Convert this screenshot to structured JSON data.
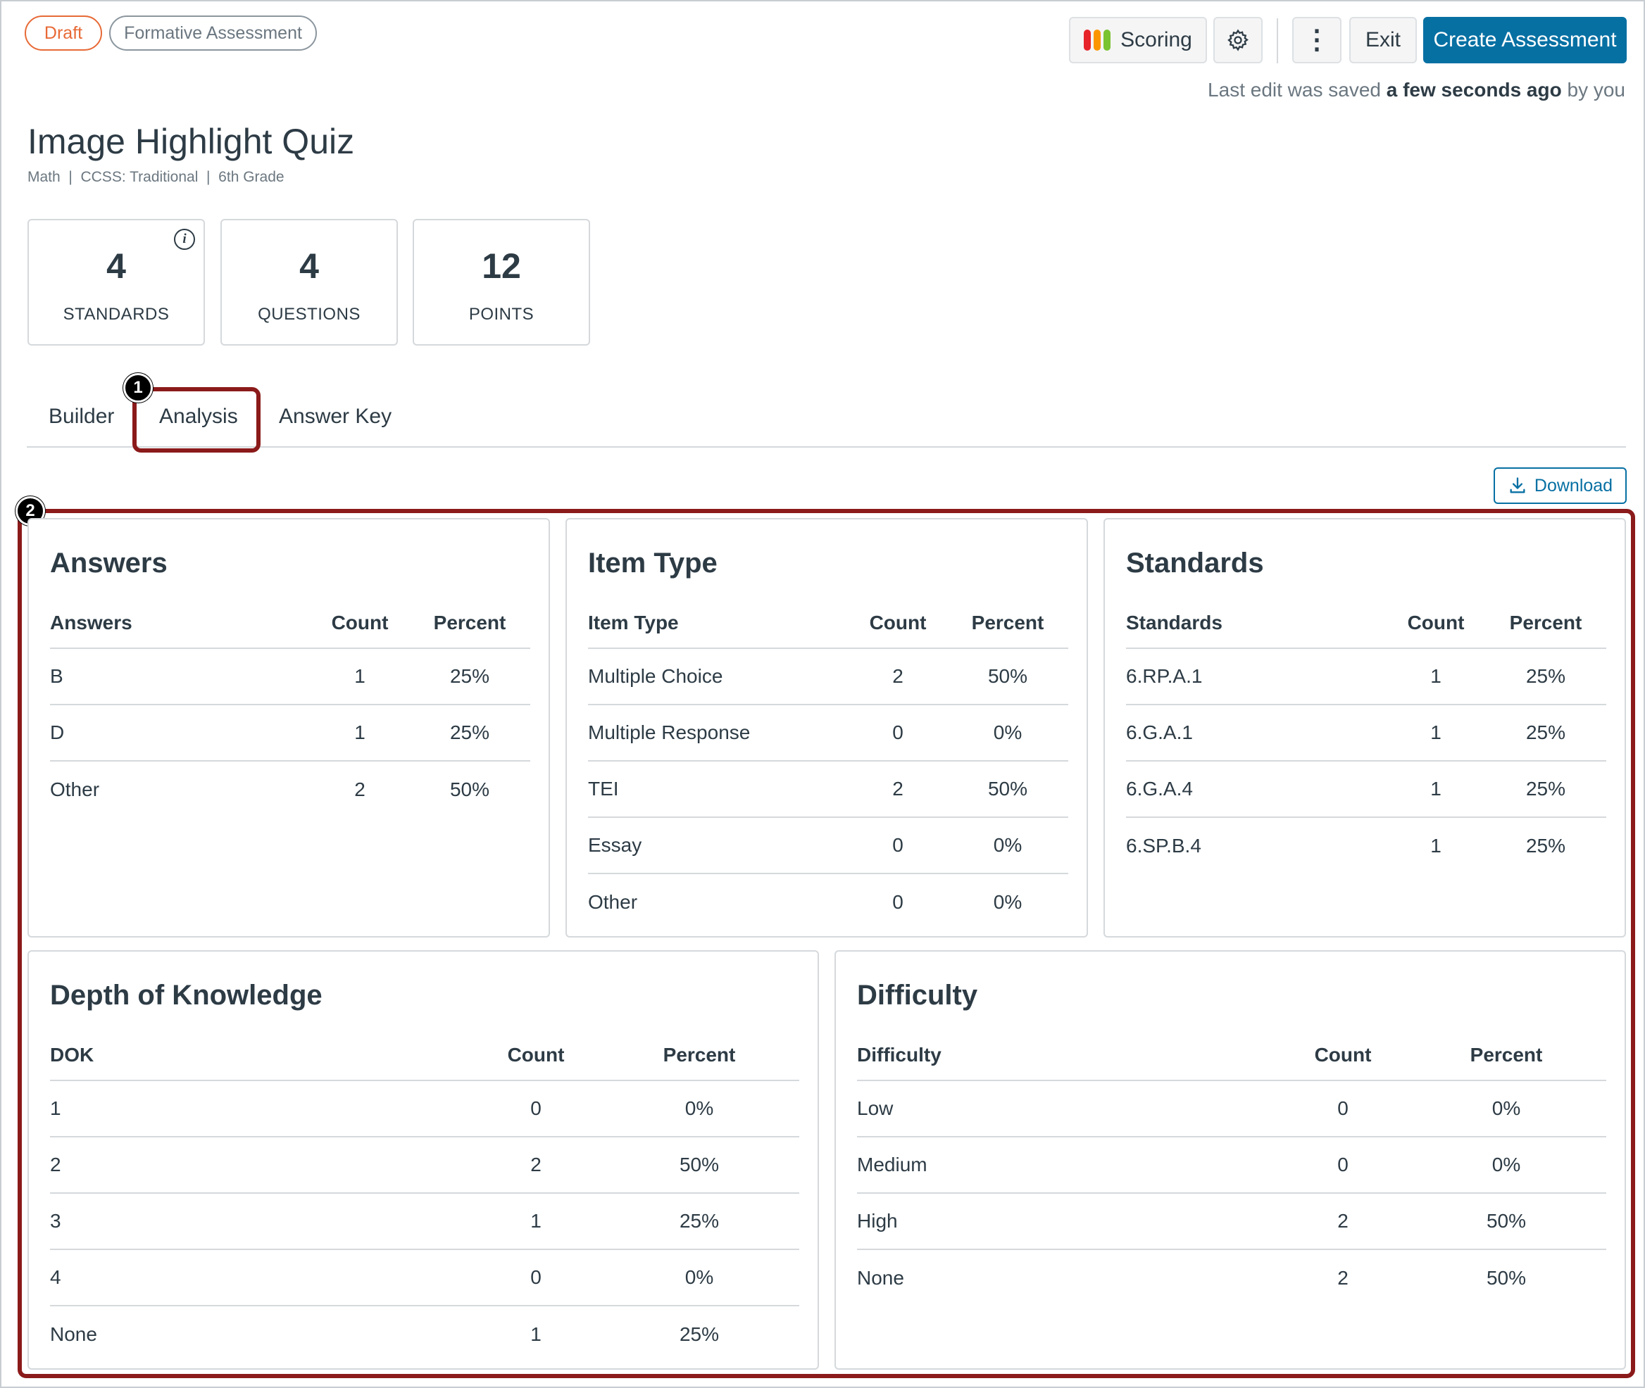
{
  "pills": {
    "draft": "Draft",
    "formative": "Formative Assessment"
  },
  "toolbar": {
    "scoring_label": "Scoring",
    "exit_label": "Exit",
    "create_label": "Create Assessment",
    "kebab": "⋮"
  },
  "saved": {
    "prefix": "Last edit was saved",
    "bold": "a few seconds ago",
    "suffix": "by you"
  },
  "header": {
    "title": "Image Highlight Quiz",
    "subtitle": "Math  |  CCSS: Traditional  |  6th Grade"
  },
  "stats": [
    {
      "value": "4",
      "label": "STANDARDS"
    },
    {
      "value": "4",
      "label": "QUESTIONS"
    },
    {
      "value": "12",
      "label": "POINTS"
    }
  ],
  "tabs": {
    "builder": "Builder",
    "analysis": "Analysis",
    "answer_key": "Answer Key"
  },
  "badges": {
    "one": "1",
    "two": "2"
  },
  "download_label": "Download",
  "colors": {
    "primary": "#0770a3",
    "draft": "#e76a36",
    "callout": "#8b1a1a",
    "bar_red": "#e62429",
    "bar_yellow": "#fc9600",
    "bar_green": "#7ac331"
  },
  "cards": {
    "answers": {
      "title": "Answers",
      "headers": [
        "Answers",
        "Count",
        "Percent"
      ],
      "rows": [
        [
          "B",
          "1",
          "25%"
        ],
        [
          "D",
          "1",
          "25%"
        ],
        [
          "Other",
          "2",
          "50%"
        ]
      ]
    },
    "item_type": {
      "title": "Item Type",
      "headers": [
        "Item Type",
        "Count",
        "Percent"
      ],
      "rows": [
        [
          "Multiple Choice",
          "2",
          "50%"
        ],
        [
          "Multiple Response",
          "0",
          "0%"
        ],
        [
          "TEI",
          "2",
          "50%"
        ],
        [
          "Essay",
          "0",
          "0%"
        ],
        [
          "Other",
          "0",
          "0%"
        ]
      ]
    },
    "standards": {
      "title": "Standards",
      "headers": [
        "Standards",
        "Count",
        "Percent"
      ],
      "rows": [
        [
          "6.RP.A.1",
          "1",
          "25%"
        ],
        [
          "6.G.A.1",
          "1",
          "25%"
        ],
        [
          "6.G.A.4",
          "1",
          "25%"
        ],
        [
          "6.SP.B.4",
          "1",
          "25%"
        ]
      ]
    },
    "dok": {
      "title": "Depth of Knowledge",
      "headers": [
        "DOK",
        "Count",
        "Percent"
      ],
      "rows": [
        [
          "1",
          "0",
          "0%"
        ],
        [
          "2",
          "2",
          "50%"
        ],
        [
          "3",
          "1",
          "25%"
        ],
        [
          "4",
          "0",
          "0%"
        ],
        [
          "None",
          "1",
          "25%"
        ]
      ]
    },
    "difficulty": {
      "title": "Difficulty",
      "headers": [
        "Difficulty",
        "Count",
        "Percent"
      ],
      "rows": [
        [
          "Low",
          "0",
          "0%"
        ],
        [
          "Medium",
          "0",
          "0%"
        ],
        [
          "High",
          "2",
          "50%"
        ],
        [
          "None",
          "2",
          "50%"
        ]
      ]
    }
  }
}
